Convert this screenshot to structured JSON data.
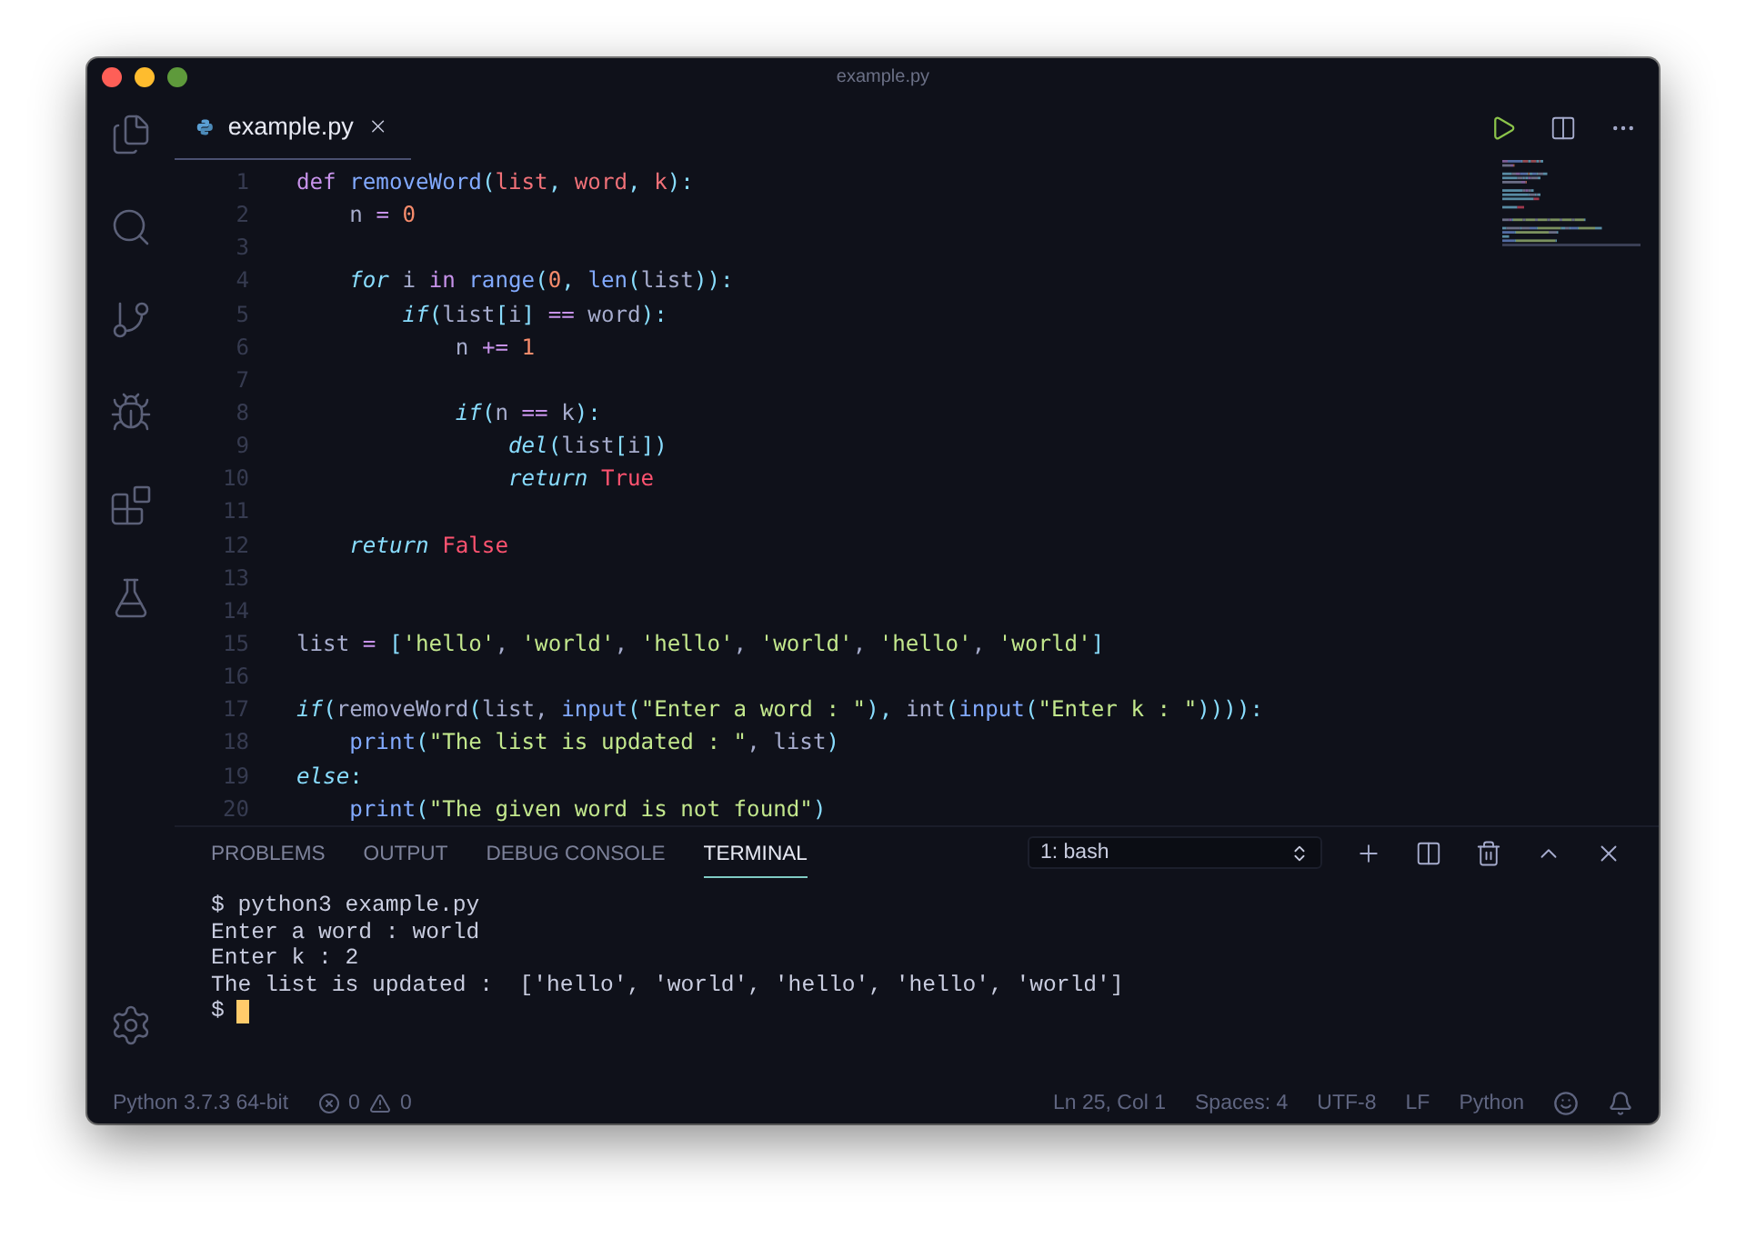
{
  "window": {
    "title": "example.py"
  },
  "editor_tab": {
    "label": "example.py",
    "selected": true
  },
  "code_lines": [
    {
      "number": "1",
      "tokens": [
        {
          "text": "def ",
          "kind": "kw"
        },
        {
          "text": "removeWord",
          "kind": "fn"
        },
        {
          "text": "(",
          "kind": "punc"
        },
        {
          "text": "list",
          "kind": "param"
        },
        {
          "text": ", ",
          "kind": "punc"
        },
        {
          "text": "word",
          "kind": "param"
        },
        {
          "text": ", ",
          "kind": "punc"
        },
        {
          "text": "k",
          "kind": "param"
        },
        {
          "text": "):",
          "kind": "punc"
        }
      ]
    },
    {
      "number": "2",
      "tokens": [
        {
          "text": "    n ",
          "kind": "txt"
        },
        {
          "text": "= ",
          "kind": "op"
        },
        {
          "text": "0",
          "kind": "num"
        }
      ]
    },
    {
      "number": "3"
    },
    {
      "number": "4",
      "tokens": [
        {
          "text": "    for",
          "kind": "ctl"
        },
        {
          "text": " i ",
          "kind": "txt"
        },
        {
          "text": "in ",
          "kind": "op"
        },
        {
          "text": "range",
          "kind": "fn"
        },
        {
          "text": "(",
          "kind": "punc"
        },
        {
          "text": "0",
          "kind": "num"
        },
        {
          "text": ", ",
          "kind": "punc"
        },
        {
          "text": "len",
          "kind": "fn"
        },
        {
          "text": "(",
          "kind": "punc"
        },
        {
          "text": "list",
          "kind": "txt"
        },
        {
          "text": ")):",
          "kind": "punc"
        }
      ]
    },
    {
      "number": "5",
      "tokens": [
        {
          "text": "        if",
          "kind": "ctl"
        },
        {
          "text": "(",
          "kind": "punc"
        },
        {
          "text": "list",
          "kind": "txt"
        },
        {
          "text": "[",
          "kind": "punc"
        },
        {
          "text": "i",
          "kind": "txt"
        },
        {
          "text": "] ",
          "kind": "punc"
        },
        {
          "text": "==",
          "kind": "op"
        },
        {
          "text": " word",
          "kind": "txt"
        },
        {
          "text": "):",
          "kind": "punc"
        }
      ]
    },
    {
      "number": "6",
      "tokens": [
        {
          "text": "            n ",
          "kind": "txt"
        },
        {
          "text": "+= ",
          "kind": "op"
        },
        {
          "text": "1",
          "kind": "num"
        }
      ]
    },
    {
      "number": "7"
    },
    {
      "number": "8",
      "tokens": [
        {
          "text": "            if",
          "kind": "ctl"
        },
        {
          "text": "(",
          "kind": "punc"
        },
        {
          "text": "n ",
          "kind": "txt"
        },
        {
          "text": "==",
          "kind": "op"
        },
        {
          "text": " k",
          "kind": "txt"
        },
        {
          "text": "):",
          "kind": "punc"
        }
      ]
    },
    {
      "number": "9",
      "tokens": [
        {
          "text": "                del",
          "kind": "ctl"
        },
        {
          "text": "(",
          "kind": "punc"
        },
        {
          "text": "list",
          "kind": "txt"
        },
        {
          "text": "[",
          "kind": "punc"
        },
        {
          "text": "i",
          "kind": "txt"
        },
        {
          "text": "])",
          "kind": "punc"
        }
      ]
    },
    {
      "number": "10",
      "tokens": [
        {
          "text": "                return ",
          "kind": "ctl"
        },
        {
          "text": "True",
          "kind": "const"
        }
      ]
    },
    {
      "number": "11"
    },
    {
      "number": "12",
      "tokens": [
        {
          "text": "    return ",
          "kind": "ctl"
        },
        {
          "text": "False",
          "kind": "const"
        }
      ]
    },
    {
      "number": "13"
    },
    {
      "number": "14"
    },
    {
      "number": "15",
      "tokens": [
        {
          "text": "list ",
          "kind": "txt"
        },
        {
          "text": "= ",
          "kind": "op"
        },
        {
          "text": "[",
          "kind": "punc"
        },
        {
          "text": "'hello'",
          "kind": "str"
        },
        {
          "text": ", ",
          "kind": "txt"
        },
        {
          "text": "'world'",
          "kind": "str"
        },
        {
          "text": ", ",
          "kind": "txt"
        },
        {
          "text": "'hello'",
          "kind": "str"
        },
        {
          "text": ", ",
          "kind": "txt"
        },
        {
          "text": "'world'",
          "kind": "str"
        },
        {
          "text": ", ",
          "kind": "txt"
        },
        {
          "text": "'hello'",
          "kind": "str"
        },
        {
          "text": ", ",
          "kind": "txt"
        },
        {
          "text": "'world'",
          "kind": "str"
        },
        {
          "text": "]",
          "kind": "punc"
        }
      ]
    },
    {
      "number": "16"
    },
    {
      "number": "17",
      "tokens": [
        {
          "text": "if",
          "kind": "ctl"
        },
        {
          "text": "(",
          "kind": "punc"
        },
        {
          "text": "removeWord",
          "kind": "txt"
        },
        {
          "text": "(",
          "kind": "punc"
        },
        {
          "text": "list, ",
          "kind": "txt"
        },
        {
          "text": "input",
          "kind": "fn"
        },
        {
          "text": "(",
          "kind": "punc"
        },
        {
          "text": "\"Enter a word : \"",
          "kind": "str"
        },
        {
          "text": "), ",
          "kind": "punc"
        },
        {
          "text": "int",
          "kind": "txt"
        },
        {
          "text": "(",
          "kind": "punc"
        },
        {
          "text": "input",
          "kind": "fn"
        },
        {
          "text": "(",
          "kind": "punc"
        },
        {
          "text": "\"Enter k : \"",
          "kind": "str"
        },
        {
          "text": ")))):",
          "kind": "punc"
        }
      ]
    },
    {
      "number": "18",
      "tokens": [
        {
          "text": "    print",
          "kind": "fn"
        },
        {
          "text": "(",
          "kind": "punc"
        },
        {
          "text": "\"The list is updated : \"",
          "kind": "str"
        },
        {
          "text": ", list",
          "kind": "txt"
        },
        {
          "text": ")",
          "kind": "punc"
        }
      ]
    },
    {
      "number": "19",
      "tokens": [
        {
          "text": "else",
          "kind": "ctl"
        },
        {
          "text": ":",
          "kind": "punc"
        }
      ]
    },
    {
      "number": "20",
      "tokens": [
        {
          "text": "    print",
          "kind": "fn"
        },
        {
          "text": "(",
          "kind": "punc"
        },
        {
          "text": "\"The given word is not found\"",
          "kind": "str"
        },
        {
          "text": ")",
          "kind": "punc"
        }
      ]
    }
  ],
  "panel": {
    "tabs": [
      {
        "label": "PROBLEMS",
        "selected": false
      },
      {
        "label": "OUTPUT",
        "selected": false
      },
      {
        "label": "DEBUG CONSOLE",
        "selected": false
      },
      {
        "label": "TERMINAL",
        "selected": true
      }
    ],
    "terminal_select": "1: bash",
    "terminal_lines": [
      "$ python3 example.py",
      "Enter a word : world",
      "Enter k : 2",
      "The list is updated :  ['hello', 'world', 'hello', 'hello', 'world']"
    ],
    "prompt": "$"
  },
  "status_bar": {
    "interpreter": "Python 3.7.3 64-bit",
    "errors": "0",
    "warnings": "0",
    "position": "Ln 25, Col 1",
    "spaces": "Spaces: 4",
    "encoding": "UTF-8",
    "eol": "LF",
    "language": "Python"
  }
}
